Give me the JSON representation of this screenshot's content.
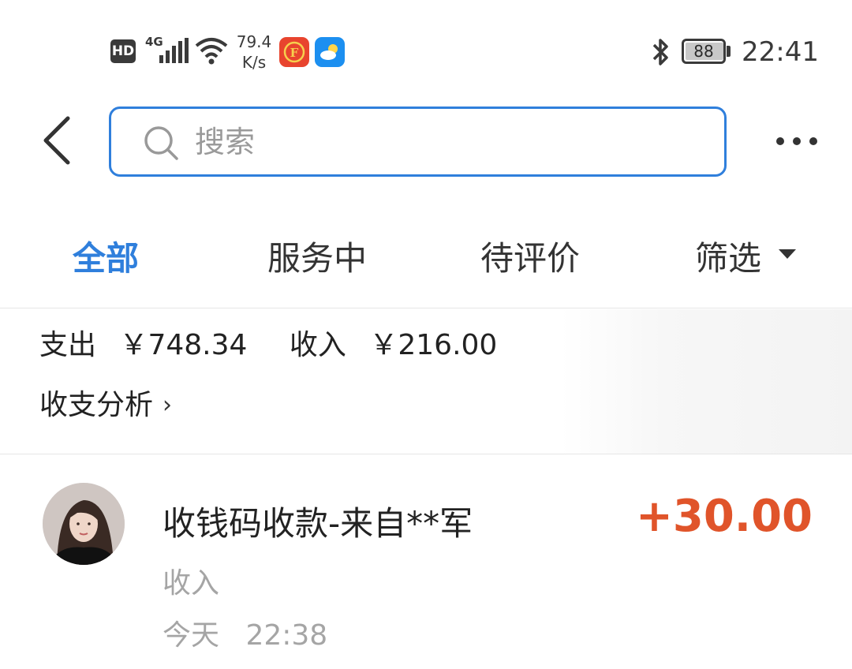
{
  "status_bar": {
    "hd_label": "HD",
    "network_label": "4G",
    "speed_value": "79.4",
    "speed_unit": "K/s",
    "battery": "88",
    "time": "22:41",
    "icons": [
      "signal-icon",
      "wifi-icon",
      "app-notification-icon",
      "weather-app-icon",
      "bluetooth-icon",
      "battery-icon"
    ]
  },
  "header": {
    "back_icon": "chevron-left-icon",
    "search_placeholder": "搜索",
    "search_value": "",
    "more_icon": "more-dots-icon"
  },
  "tabs": [
    {
      "label": "全部",
      "active": true
    },
    {
      "label": "服务中",
      "active": false
    },
    {
      "label": "待评价",
      "active": false
    },
    {
      "label": "筛选",
      "active": false
    }
  ],
  "summary": {
    "expense_label": "支出",
    "expense_value": "￥748.34",
    "income_label": "收入",
    "income_value": "￥216.00",
    "analysis_label": "收支分析",
    "analysis_chevron": "›"
  },
  "transactions": [
    {
      "title": "收钱码收款-来自**军",
      "amount": "+30.00",
      "type": "收入",
      "date": "今天",
      "time": "22:38",
      "amount_color": "#e0542a"
    }
  ],
  "colors": {
    "accent": "#2f7fdc",
    "income_amount": "#e0542a",
    "muted_text": "#a5a5a5"
  }
}
